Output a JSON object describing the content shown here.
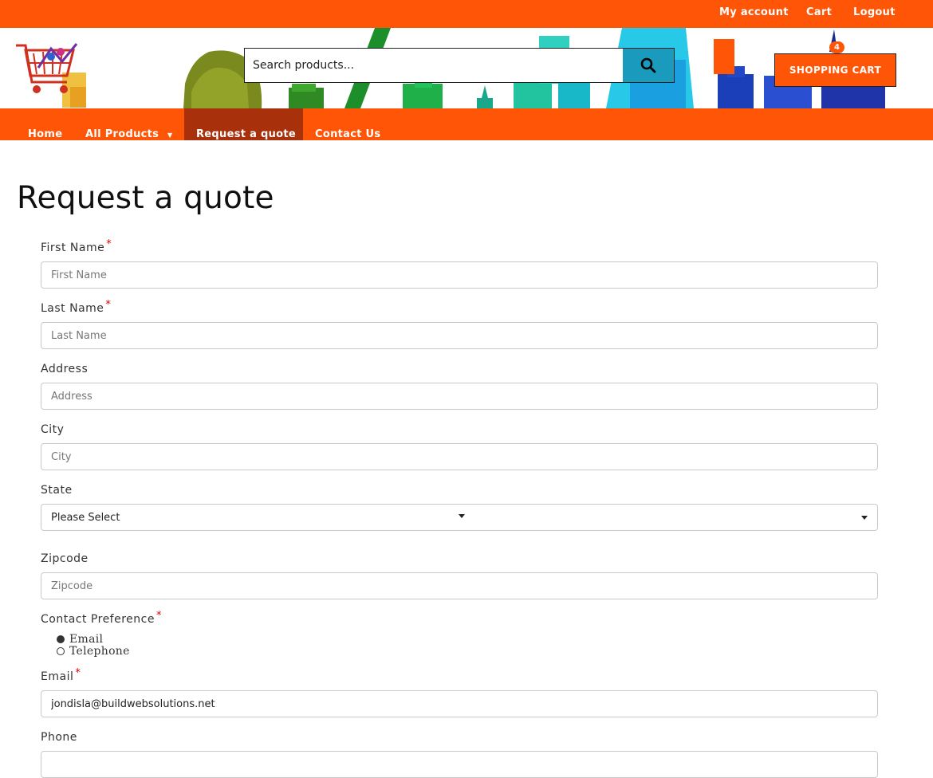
{
  "topbar": {
    "links": [
      "My account",
      "Cart",
      "Logout"
    ]
  },
  "header": {
    "search_placeholder": "Search products...",
    "cart_button": "SHOPPING CART",
    "cart_count": "4"
  },
  "nav": {
    "items": [
      "Home",
      "All Products",
      "Request a quote",
      "Contact Us"
    ],
    "active": "Request a quote"
  },
  "page": {
    "title": "Request a quote"
  },
  "form": {
    "first_name": {
      "label": "First Name",
      "required": "*",
      "placeholder": "First Name"
    },
    "last_name": {
      "label": "Last Name",
      "required": "*",
      "placeholder": "Last Name"
    },
    "address": {
      "label": "Address",
      "placeholder": "Address"
    },
    "city": {
      "label": "City",
      "placeholder": "City"
    },
    "state": {
      "label": "State",
      "value": "Please Select"
    },
    "zipcode": {
      "label": "Zipcode",
      "placeholder": "Zipcode"
    },
    "contact_preference": {
      "label": "Contact Preference",
      "required": "*",
      "options": [
        "Email",
        "Telephone"
      ],
      "selected": "Email"
    },
    "email": {
      "label": "Email",
      "required": "*",
      "value": "jondisla@buildwebsolutions.net"
    },
    "phone": {
      "label": "Phone"
    }
  },
  "colors": {
    "brand": "#ff5507",
    "nav_active": "#a8300a",
    "search_button": "#1a9bbd"
  }
}
